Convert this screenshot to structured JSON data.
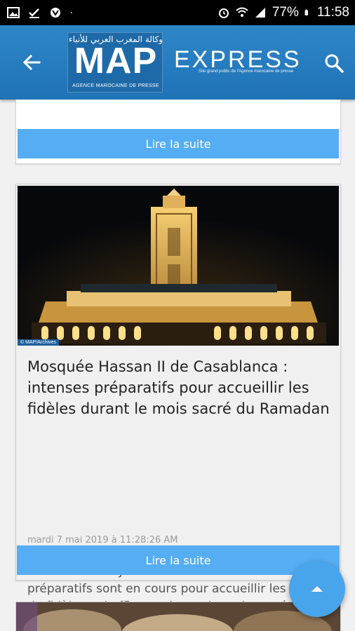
{
  "status_bar": {
    "battery": "77%",
    "time": "11:58"
  },
  "header": {
    "logo_arabic": "وكالة المغرب العربي للأنباء",
    "logo_text": "MAP",
    "logo_subtitle": "AGENCE MAROCAINE DE PRESSE",
    "express_text": "EXPRESS",
    "express_subtitle": "Site grand public de l'Agence marocaine de presse"
  },
  "cards": [
    {
      "read_more_label": "Lire la suite"
    },
    {
      "image_credit": "© MAP/Archives",
      "title": "Mosquée Hassan II de Casablanca : intenses préparatifs pour accueillir les fidèles durant le mois sacré du Ramadan",
      "date": "mardi 7 mai 2019 à 11:28:26 AM",
      "excerpt": "--Par Abdellatif Jaafari-- Casablanca - D'intenses préparatifs sont en cours pour accueillir les masses de fidèles qui affluent, durant le mois sacré du Ramadan...",
      "read_more_label": "Lire la suite"
    }
  ],
  "icons": {
    "back": "arrow-left-icon",
    "search": "search-icon",
    "scroll_top": "chevron-up-icon"
  }
}
